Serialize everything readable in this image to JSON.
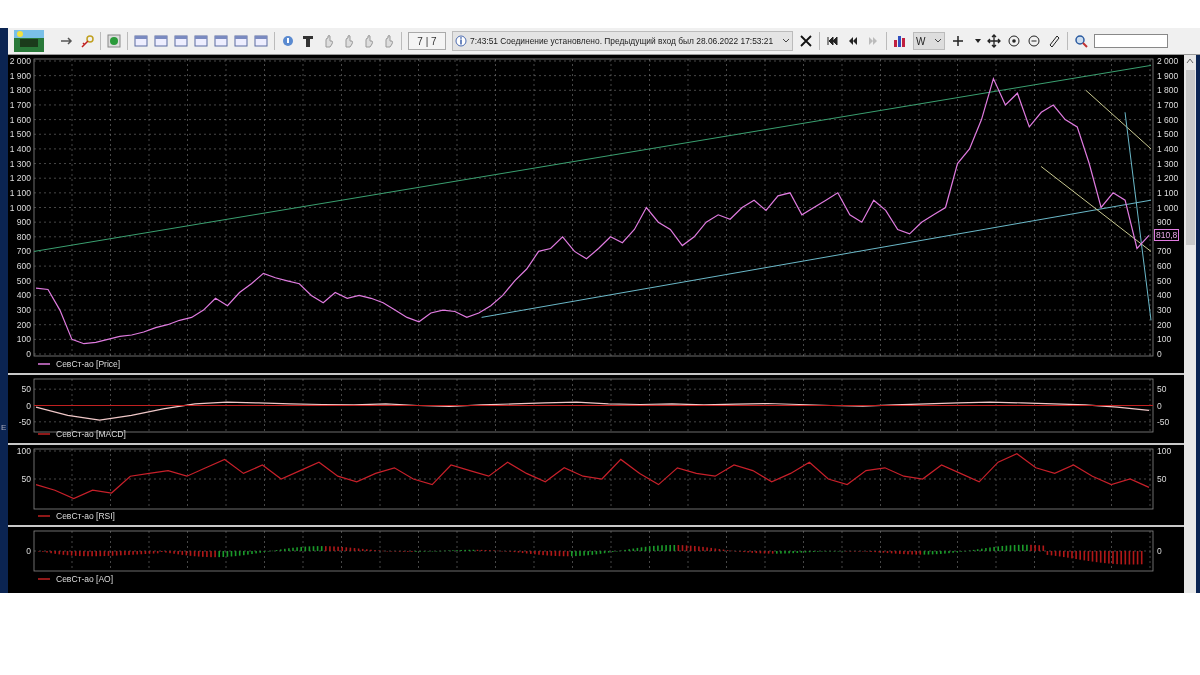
{
  "toolbar": {
    "counter": "7 | 7",
    "message": "7:43:51  Соединение установлено. Предыдущий вход был 28.06.2022 17:53:21",
    "interval": "W"
  },
  "side_mark": "E",
  "panels": [
    {
      "last_value": "810,8",
      "right_axis_labels": [
        "2 000",
        "1 900",
        "1 800",
        "1 700",
        "1 600",
        "1 500",
        "1 400",
        "1 300",
        "1 200",
        "1 100",
        "1 000",
        "900",
        "700",
        "600",
        "500",
        "400",
        "300",
        "200",
        "100",
        "0"
      ],
      "chart_data": {
        "type": "line",
        "grid": true,
        "ylim": [
          0,
          2000
        ],
        "yticks": [
          {
            "value": 2000,
            "label": "2 000"
          },
          {
            "value": 1900,
            "label": "1 900"
          },
          {
            "value": 1800,
            "label": "1 800"
          },
          {
            "value": 1700,
            "label": "1 700"
          },
          {
            "value": 1600,
            "label": "1 600"
          },
          {
            "value": 1500,
            "label": "1 500"
          },
          {
            "value": 1400,
            "label": "1 400"
          },
          {
            "value": 1300,
            "label": "1 300"
          },
          {
            "value": 1200,
            "label": "1 200"
          },
          {
            "value": 1100,
            "label": "1 100"
          },
          {
            "value": 1000,
            "label": "1 000"
          },
          900,
          800,
          700,
          600,
          500,
          400,
          300,
          200,
          100,
          0
        ],
        "series": [
          {
            "name": "СевСт-ао [Price]",
            "color": "#e07be0",
            "values": [
              450,
              440,
              300,
              100,
              70,
              80,
              100,
              120,
              130,
              150,
              180,
              200,
              230,
              250,
              300,
              380,
              330,
              420,
              480,
              550,
              520,
              500,
              480,
              400,
              350,
              420,
              380,
              400,
              380,
              350,
              300,
              250,
              220,
              280,
              300,
              290,
              250,
              280,
              330,
              400,
              500,
              580,
              700,
              720,
              800,
              700,
              650,
              720,
              800,
              760,
              850,
              1000,
              900,
              850,
              740,
              800,
              900,
              950,
              920,
              1000,
              1050,
              980,
              1080,
              1100,
              950,
              1000,
              1050,
              1100,
              950,
              900,
              1050,
              980,
              850,
              820,
              900,
              950,
              1000,
              1300,
              1400,
              1600,
              1880,
              1700,
              1780,
              1550,
              1650,
              1700,
              1600,
              1550,
              1300,
              1000,
              1100,
              1050,
              720,
              810
            ]
          }
        ]
      }
    },
    {
      "right_axis_labels": [
        "50",
        "0",
        "-50"
      ],
      "chart_data": {
        "type": "line",
        "grid": true,
        "ylim": [
          -75,
          75
        ],
        "yticks": [
          50,
          0,
          -50
        ],
        "series": [
          {
            "name": "СевСт-ао [MACD]",
            "color": "#f0c8c8",
            "values": [
              -5,
              -30,
              -45,
              -30,
              -10,
              5,
              10,
              8,
              5,
              3,
              2,
              5,
              0,
              -3,
              2,
              5,
              8,
              10,
              5,
              3,
              5,
              2,
              4,
              6,
              3,
              0,
              -2,
              2,
              5,
              8,
              10,
              8,
              5,
              2,
              -5,
              -15
            ]
          }
        ]
      }
    },
    {
      "right_axis_labels": [
        "100",
        "50"
      ],
      "chart_data": {
        "type": "line",
        "grid": true,
        "ylim": [
          0,
          100
        ],
        "yticks": [
          100,
          50
        ],
        "series": [
          {
            "name": "СевСт-ао [RSI]",
            "color": "#c8202a",
            "values": [
              40,
              30,
              15,
              30,
              25,
              55,
              60,
              65,
              55,
              70,
              85,
              60,
              75,
              50,
              65,
              80,
              55,
              45,
              60,
              70,
              50,
              40,
              75,
              65,
              55,
              80,
              60,
              45,
              70,
              55,
              50,
              85,
              60,
              40,
              70,
              60,
              55,
              75,
              65,
              45,
              60,
              80,
              50,
              40,
              65,
              70,
              55,
              50,
              75,
              60,
              45,
              80,
              95,
              70,
              60,
              75,
              55,
              40,
              50,
              35
            ]
          }
        ]
      }
    },
    {
      "legend": "СевСт-ао [AO]",
      "left_zero_label": "0",
      "right_zero_label": "0"
    }
  ]
}
